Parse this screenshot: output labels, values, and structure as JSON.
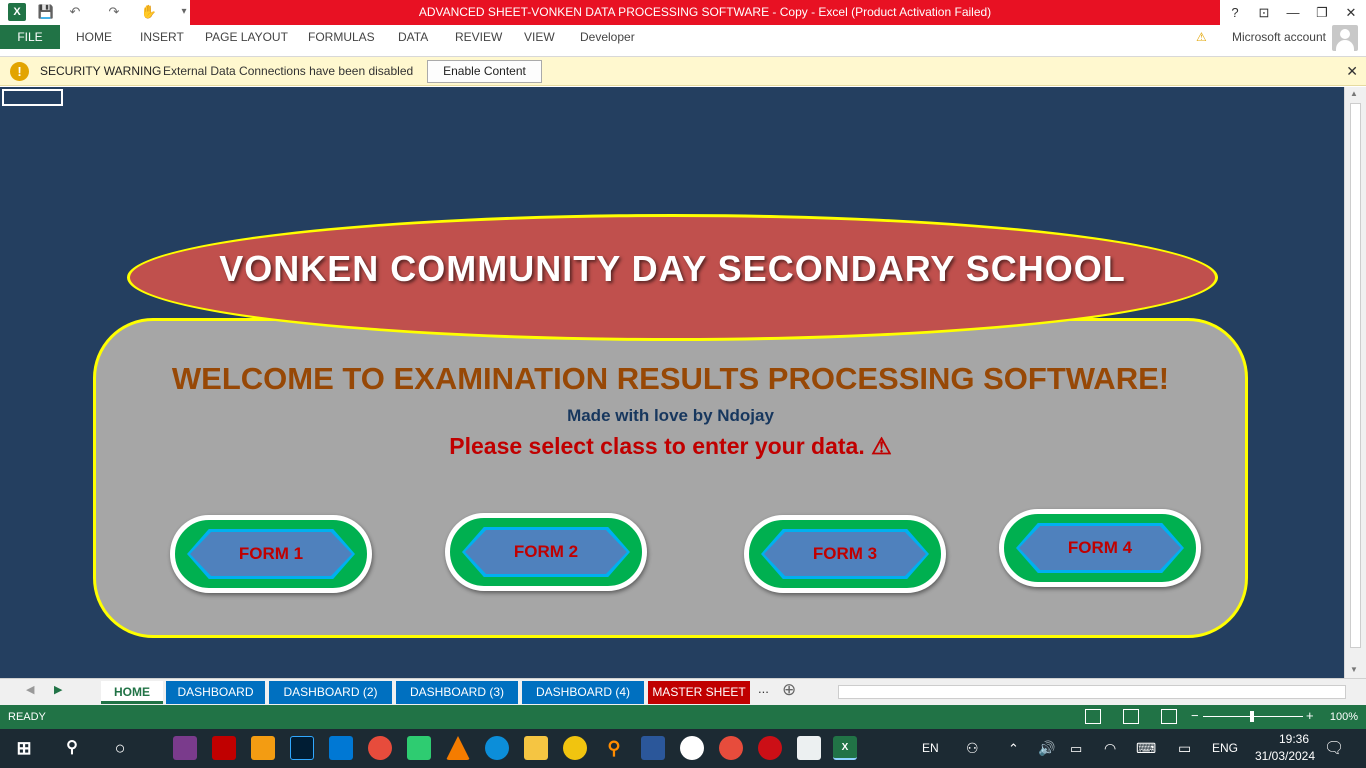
{
  "window": {
    "title": "ADVANCED SHEET-VONKEN DATA PROCESSING SOFTWARE - Copy -  Excel (Product Activation Failed)",
    "controls": [
      "?",
      "⊡",
      "—",
      "❐",
      "✕"
    ]
  },
  "ribbon": {
    "file": "FILE",
    "tabs": [
      "HOME",
      "INSERT",
      "PAGE LAYOUT",
      "FORMULAS",
      "DATA",
      "REVIEW",
      "VIEW",
      "Developer"
    ],
    "account": "Microsoft account"
  },
  "security": {
    "title": "SECURITY WARNING",
    "message": "External Data Connections have been disabled",
    "button": "Enable Content",
    "close": "✕"
  },
  "dashboard": {
    "school_name": "VONKEN COMMUNITY DAY SECONDARY SCHOOL",
    "welcome": "WELCOME TO EXAMINATION RESULTS PROCESSING SOFTWARE!",
    "made_by": "Made with love by Ndojay",
    "instruction": "Please select class to enter your data. ⚠",
    "forms": [
      "FORM 1",
      "FORM 2",
      "FORM 3",
      "FORM 4"
    ]
  },
  "sheet_tabs": {
    "tabs": [
      "HOME",
      "DASHBOARD",
      "DASHBOARD (2)",
      "DASHBOARD (3)",
      "DASHBOARD (4)",
      "MASTER SHEET"
    ],
    "more": "...",
    "add": "⊕",
    "colors": {
      "blue": "#0070c0",
      "red": "#c00000",
      "active": "#217346"
    }
  },
  "status": {
    "mode": "READY",
    "zoom": "100%"
  },
  "taskbar": {
    "lang1": "EN",
    "lang2": "ENG",
    "time": "19:36",
    "date": "31/03/2024"
  }
}
